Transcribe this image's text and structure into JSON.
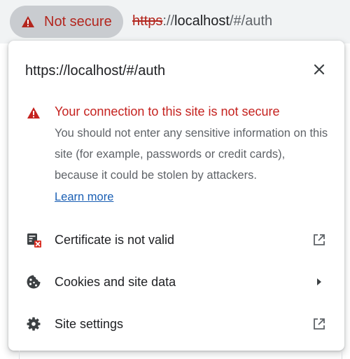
{
  "omnibox": {
    "chip_label": "Not secure",
    "url_scheme": "https",
    "url_separator": "://",
    "url_host": "localhost",
    "url_path": "/#/auth",
    "chip_icon": "warning-triangle-icon"
  },
  "popup": {
    "url": "https://localhost/#/auth",
    "close_icon": "close-icon",
    "warning": {
      "title": "Your connection to this site is not secure",
      "body": "You should not enter any sensitive information on this site (for example, passwords or credit cards), because it could be stolen by attackers.",
      "learn_more": "Learn more",
      "icon": "warning-triangle-icon"
    },
    "items": [
      {
        "label": "Certificate is not valid",
        "icon": "certificate-invalid-icon",
        "trailing_icon": "open-external-icon"
      },
      {
        "label": "Cookies and site data",
        "icon": "cookie-icon",
        "trailing_icon": "arrow-right-icon"
      },
      {
        "label": "Site settings",
        "icon": "gear-icon",
        "trailing_icon": "open-external-icon"
      }
    ]
  },
  "colors": {
    "danger": "#c5221f",
    "link": "#1a5fb4",
    "chip_background": "#c9ccd0",
    "secondary_text": "#5f6368",
    "primary_text": "#202124"
  }
}
